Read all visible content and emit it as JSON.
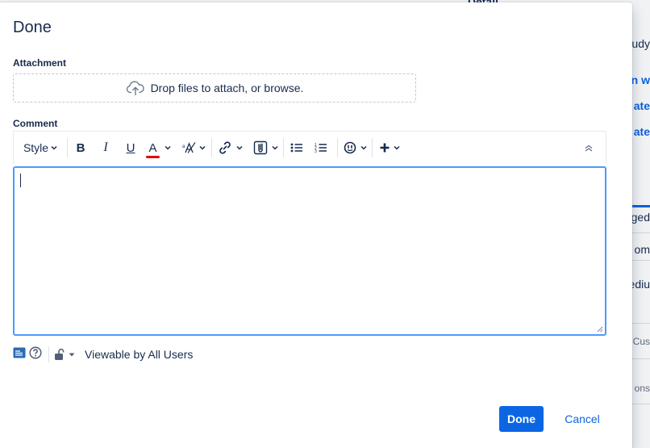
{
  "background": {
    "fragments": [
      "Detail",
      "rudy",
      "en w",
      "ate",
      "ate",
      "ged",
      "om",
      "ediu",
      "Cus",
      "ons"
    ]
  },
  "modal": {
    "title": "Done",
    "attachment": {
      "label": "Attachment",
      "dropzone_text": "Drop files to attach, or browse."
    },
    "comment": {
      "label": "Comment",
      "toolbar": {
        "style_label": "Style",
        "bold_label": "B",
        "italic_label": "I",
        "underline_label": "U",
        "text_color_label": "A",
        "text_color": "#e5000b"
      },
      "value": ""
    },
    "visibility": {
      "label": "Viewable by All Users"
    },
    "buttons": {
      "done_label": "Done",
      "cancel_label": "Cancel"
    }
  },
  "colors": {
    "primary": "#0c66e4",
    "focus_border": "#4c9aff",
    "text": "#172b4d"
  }
}
